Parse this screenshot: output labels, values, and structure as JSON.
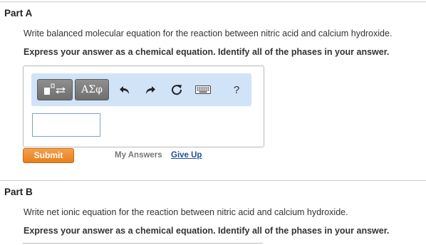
{
  "part_a": {
    "title": "Part A",
    "prompt": "Write balanced molecular equation for the reaction between nitric acid and calcium hydroxide.",
    "instruction": "Express your answer as a chemical equation. Identify all of the phases in your answer.",
    "toolbar": {
      "greek_label": "ΑΣφ",
      "help_label": "?",
      "icons": [
        "templates-icon",
        "greek-symbols-icon",
        "undo-icon",
        "redo-icon",
        "reset-icon",
        "keyboard-icon",
        "help-icon"
      ]
    },
    "answer_value": "",
    "submit_label": "Submit",
    "my_answers_label": "My Answers",
    "give_up_label": "Give Up"
  },
  "part_b": {
    "title": "Part B",
    "prompt": "Write net ionic equation for the reaction between nitric acid and calcium hydroxide.",
    "instruction": "Express your answer as a chemical equation. Identify all of the phases in your answer."
  },
  "colors": {
    "toolbar_bg": "#d1e3f7",
    "submit_bg": "#e8821f",
    "link": "#1f4e9a",
    "input_border": "#7ea3c8"
  }
}
